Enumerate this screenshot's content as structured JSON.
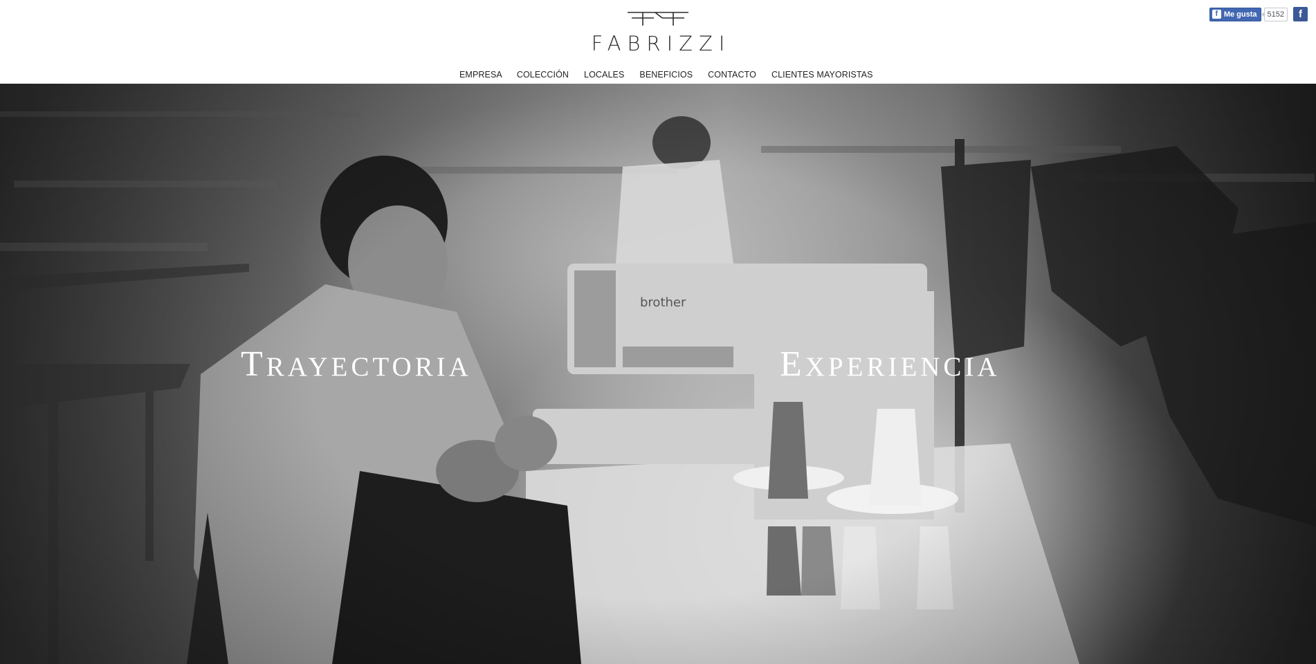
{
  "brand": {
    "name": "FABRIZZI",
    "logo_icon": "ff-monogram-icon"
  },
  "facebook": {
    "like_label": "Me gusta",
    "like_count": "5152",
    "like_icon": "facebook-thumb-icon",
    "page_icon": "facebook-icon"
  },
  "nav": {
    "items": [
      {
        "label": "EMPRESA",
        "active": true
      },
      {
        "label": "COLECCIÓN",
        "active": false
      },
      {
        "label": "LOCALES",
        "active": false
      },
      {
        "label": "BENEFICIOS",
        "active": false
      },
      {
        "label": "CONTACTO",
        "active": false
      },
      {
        "label": "CLIENTES MAYORISTAS",
        "active": false
      }
    ]
  },
  "hero": {
    "word_left": "Trayectoria",
    "word_right": "Experiencia",
    "image_description_icon": "sewing-workshop-photo",
    "machine_brand_text": "brother"
  },
  "colors": {
    "header_bg": "#ffffff",
    "text": "#222222",
    "facebook_blue": "#3b5998"
  }
}
